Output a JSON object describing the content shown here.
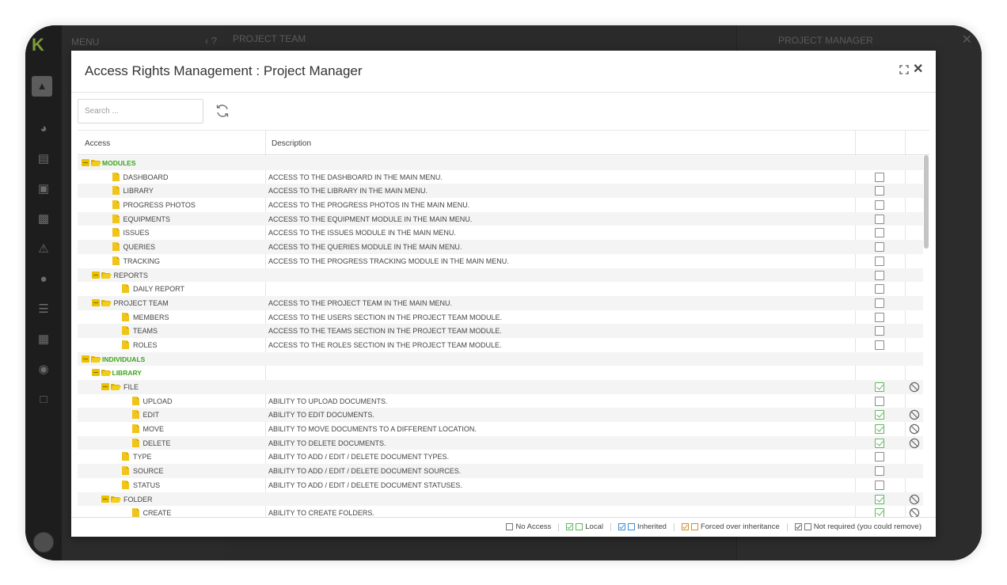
{
  "background": {
    "logo": "K",
    "menu_title": "MENU",
    "menu_controls": "‹ ?",
    "main_title": "PROJECT TEAM",
    "right_title": "PROJECT MANAGER",
    "right_close": "✕"
  },
  "modal": {
    "title": "Access Rights Management : Project Manager",
    "close": "✕"
  },
  "search": {
    "placeholder": "Search ..."
  },
  "grid": {
    "headers": {
      "access": "Access",
      "description": "Description"
    },
    "rows": [
      {
        "level": 0,
        "kind": "group",
        "label": "MODULES",
        "desc": "",
        "state": "none"
      },
      {
        "level": 1,
        "kind": "file",
        "label": "DASHBOARD",
        "desc": "ACCESS TO THE DASHBOARD IN THE MAIN MENU.",
        "state": "empty"
      },
      {
        "level": 1,
        "kind": "file",
        "label": "LIBRARY",
        "desc": "ACCESS TO THE LIBRARY IN THE MAIN MENU.",
        "state": "empty"
      },
      {
        "level": 1,
        "kind": "file",
        "label": "PROGRESS PHOTOS",
        "desc": "ACCESS TO THE PROGRESS PHOTOS IN THE MAIN MENU.",
        "state": "empty"
      },
      {
        "level": 1,
        "kind": "file",
        "label": "EQUIPMENTS",
        "desc": "ACCESS TO THE EQUIPMENT MODULE IN THE MAIN MENU.",
        "state": "empty"
      },
      {
        "level": 1,
        "kind": "file",
        "label": "ISSUES",
        "desc": "ACCESS TO THE ISSUES MODULE IN THE MAIN MENU.",
        "state": "empty"
      },
      {
        "level": 1,
        "kind": "file",
        "label": "QUERIES",
        "desc": "ACCESS TO THE QUERIES MODULE IN THE MAIN MENU.",
        "state": "empty"
      },
      {
        "level": 1,
        "kind": "file",
        "label": "TRACKING",
        "desc": "ACCESS TO THE PROGRESS TRACKING MODULE IN THE MAIN MENU.",
        "state": "empty"
      },
      {
        "level": 1,
        "kind": "folder",
        "label": "REPORTS",
        "desc": "",
        "state": "empty"
      },
      {
        "level": 2,
        "kind": "file",
        "label": "DAILY REPORT",
        "desc": "",
        "state": "empty"
      },
      {
        "level": 1,
        "kind": "folder",
        "label": "PROJECT TEAM",
        "desc": "ACCESS TO THE PROJECT TEAM IN THE MAIN MENU.",
        "state": "empty"
      },
      {
        "level": 2,
        "kind": "file",
        "label": "MEMBERS",
        "desc": "ACCESS TO THE USERS SECTION IN THE PROJECT TEAM MODULE.",
        "state": "empty"
      },
      {
        "level": 2,
        "kind": "file",
        "label": "TEAMS",
        "desc": "ACCESS TO THE TEAMS SECTION IN THE PROJECT TEAM MODULE.",
        "state": "empty"
      },
      {
        "level": 2,
        "kind": "file",
        "label": "ROLES",
        "desc": "ACCESS TO THE ROLES SECTION IN THE PROJECT TEAM MODULE.",
        "state": "empty"
      },
      {
        "level": 0,
        "kind": "group",
        "label": "INDIVIDUALS",
        "desc": "",
        "state": "none"
      },
      {
        "level": 1,
        "kind": "group",
        "label": "LIBRARY",
        "desc": "",
        "state": "none"
      },
      {
        "level": 2,
        "kind": "folder",
        "label": "FILE",
        "desc": "",
        "state": "local"
      },
      {
        "level": 3,
        "kind": "file",
        "label": "UPLOAD",
        "desc": "ABILITY TO UPLOAD DOCUMENTS.",
        "state": "empty"
      },
      {
        "level": 3,
        "kind": "file",
        "label": "EDIT",
        "desc": "ABILITY TO EDIT DOCUMENTS.",
        "state": "local"
      },
      {
        "level": 3,
        "kind": "file",
        "label": "MOVE",
        "desc": "ABILITY TO MOVE DOCUMENTS TO A DIFFERENT LOCATION.",
        "state": "local"
      },
      {
        "level": 3,
        "kind": "file",
        "label": "DELETE",
        "desc": "ABILITY TO DELETE DOCUMENTS.",
        "state": "local"
      },
      {
        "level": 2,
        "kind": "file",
        "label": "TYPE",
        "desc": "ABILITY TO ADD / EDIT / DELETE DOCUMENT TYPES.",
        "state": "empty"
      },
      {
        "level": 2,
        "kind": "file",
        "label": "SOURCE",
        "desc": "ABILITY TO ADD / EDIT / DELETE DOCUMENT SOURCES.",
        "state": "empty"
      },
      {
        "level": 2,
        "kind": "file",
        "label": "STATUS",
        "desc": "ABILITY TO ADD / EDIT / DELETE DOCUMENT STATUSES.",
        "state": "empty"
      },
      {
        "level": 2,
        "kind": "folder",
        "label": "FOLDER",
        "desc": "",
        "state": "local"
      },
      {
        "level": 3,
        "kind": "file",
        "label": "CREATE",
        "desc": "ABILITY TO CREATE FOLDERS.",
        "state": "local"
      }
    ]
  },
  "legend": {
    "no_access": "No Access",
    "local": "Local",
    "inherited": "Inherited",
    "forced": "Forced over inheritance",
    "not_required": "Not required (you could remove)"
  },
  "colors": {
    "group_text": "#3aa41a",
    "folder": "#e8c200",
    "local_check": "#5cb85c",
    "inherited_check": "#3a8fd8",
    "forced_check": "#d98b2a"
  }
}
